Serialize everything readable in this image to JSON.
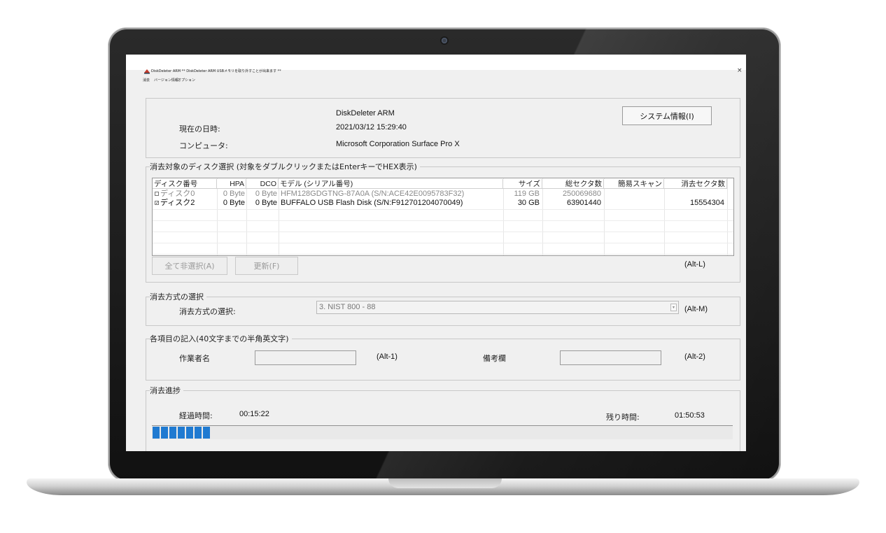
{
  "window": {
    "title": "DiskDeleter ARM ** DiskDeleter ARM USBメモリを取り外すことが出来ます **",
    "close_glyph": "×"
  },
  "menu": {
    "items": [
      "消去",
      "バージョン情報",
      "オプション"
    ]
  },
  "info": {
    "app_name": "DiskDeleter ARM",
    "datetime_label": "現在の日時:",
    "datetime_value": "2021/03/12 15:29:40",
    "computer_label": "コンピュータ:",
    "computer_value": "Microsoft Corporation Surface Pro X",
    "sysinfo_button": "システム情報(I)"
  },
  "disk_select": {
    "group_label": "消去対象のディスク選択 (対象をダブルクリックまたはEnterキーでHEX表示)",
    "columns": [
      "ディスク番号",
      "HPA",
      "DCO",
      "モデル (シリアル番号)",
      "サイズ",
      "総セクタ数",
      "簡易スキャン",
      "消去セクタ数"
    ],
    "rows": [
      {
        "checked": false,
        "enabled": false,
        "disk": "ディスク0",
        "hpa": "0 Byte",
        "dco": "0 Byte",
        "model": "HFM128GDGTNG-87A0A (S/N:ACE42E0095783F32)",
        "size": "119 GB",
        "total": "250069680",
        "scan": "",
        "erase": ""
      },
      {
        "checked": true,
        "enabled": true,
        "disk": "ディスク2",
        "hpa": "0 Byte",
        "dco": "0 Byte",
        "model": "BUFFALO USB Flash Disk (S/N:F912701204070049)",
        "size": "30 GB",
        "total": "63901440",
        "scan": "",
        "erase": "15554304"
      }
    ],
    "deselect_button": "全て非選択(A)",
    "refresh_button": "更新(F)",
    "shortcut": "(Alt-L)"
  },
  "method": {
    "group_label": "消去方式の選択",
    "label": "消去方式の選択:",
    "selected": "3. NIST 800 - 88",
    "arrow_glyph": "▾",
    "shortcut": "(Alt-M)"
  },
  "entries": {
    "group_label": "各項目の記入(40文字までの半角英文字)",
    "operator_label": "作業者名",
    "operator_value": "",
    "operator_shortcut": "(Alt-1)",
    "remarks_label": "備考欄",
    "remarks_value": "",
    "remarks_shortcut": "(Alt-2)"
  },
  "progress": {
    "group_label": "消去進捗",
    "elapsed_label": "経過時間:",
    "elapsed_value": "00:15:22",
    "remaining_label": "残り時間:",
    "remaining_value": "01:50:53",
    "blocks_filled": 7,
    "accent": "#1f7ad1"
  }
}
